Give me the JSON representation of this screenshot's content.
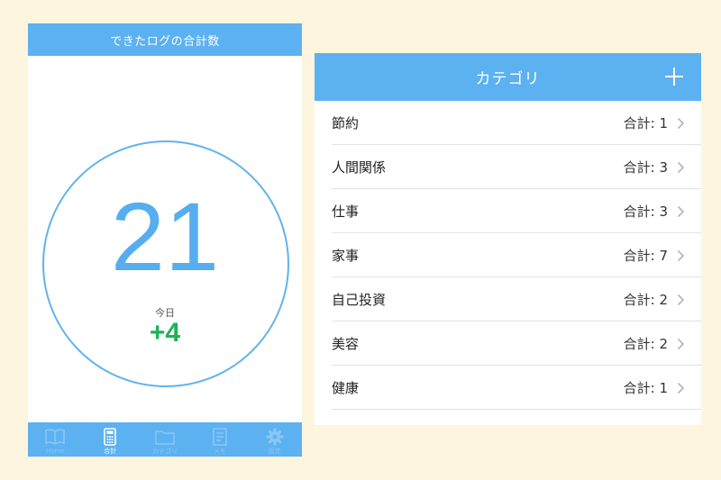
{
  "left_screen": {
    "header_title": "できたログの合計数",
    "total_count": "21",
    "today_label": "今日",
    "today_delta": "+4",
    "tabs": [
      {
        "label": "Home",
        "icon": "book-icon",
        "active": false
      },
      {
        "label": "合計",
        "icon": "calculator-icon",
        "active": true
      },
      {
        "label": "カテゴリ",
        "icon": "folder-icon",
        "active": false
      },
      {
        "label": "メモ",
        "icon": "memo-icon",
        "active": false
      },
      {
        "label": "設定",
        "icon": "gear-icon",
        "active": false
      }
    ]
  },
  "right_screen": {
    "header_title": "カテゴリ",
    "add_icon": "plus-icon",
    "categories": [
      {
        "name": "節約",
        "total": "合計: 1"
      },
      {
        "name": "人間関係",
        "total": "合計: 3"
      },
      {
        "name": "仕事",
        "total": "合計: 3"
      },
      {
        "name": "家事",
        "total": "合計: 7"
      },
      {
        "name": "自己投資",
        "total": "合計: 2"
      },
      {
        "name": "美容",
        "total": "合計: 2"
      },
      {
        "name": "健康",
        "total": "合計: 1"
      }
    ]
  },
  "colors": {
    "background": "#fdf5dd",
    "header_blue": "#5cb1f1",
    "number_blue": "#56aef0",
    "delta_green": "#1fb25b"
  }
}
